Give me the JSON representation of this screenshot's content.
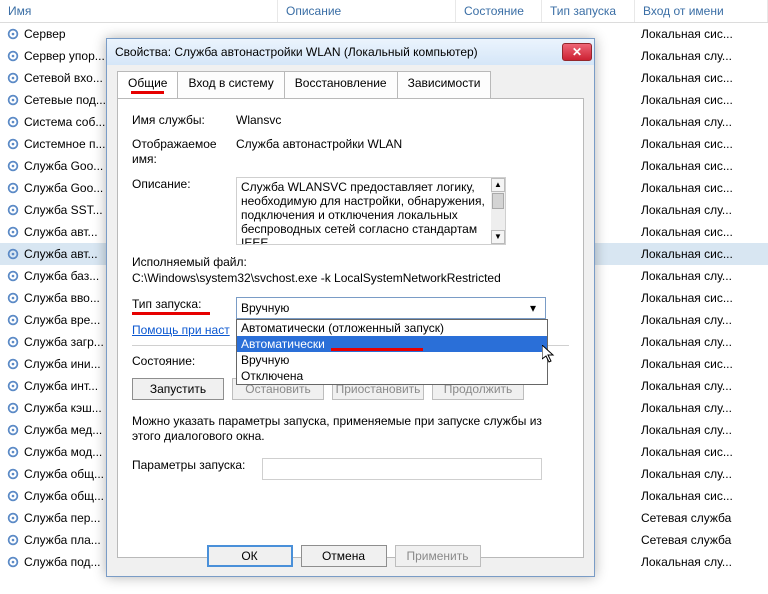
{
  "columns": {
    "name": "Имя",
    "desc": "Описание",
    "state": "Состояние",
    "start": "Тип запуска",
    "logon": "Вход от имени"
  },
  "rows": [
    {
      "name": "Сервер",
      "logon": "Локальная сис..."
    },
    {
      "name": "Сервер упор...",
      "logon": "Локальная слу..."
    },
    {
      "name": "Сетевой вхо...",
      "logon": "Локальная сис..."
    },
    {
      "name": "Сетевые под...",
      "logon": "Локальная сис..."
    },
    {
      "name": "Система соб...",
      "logon": "Локальная слу..."
    },
    {
      "name": "Системное п...",
      "logon": "Локальная сис..."
    },
    {
      "name": "Служба Goo...",
      "logon": "Локальная сис..."
    },
    {
      "name": "Служба Goo...",
      "logon": "Локальная сис..."
    },
    {
      "name": "Служба SST...",
      "logon": "Локальная слу..."
    },
    {
      "name": "Служба авт...",
      "logon": "Локальная сис..."
    },
    {
      "name": "Служба авт...",
      "sel": true,
      "logon": "Локальная сис..."
    },
    {
      "name": "Служба баз...",
      "logon": "Локальная слу..."
    },
    {
      "name": "Служба вво...",
      "logon": "Локальная сис..."
    },
    {
      "name": "Служба вре...",
      "logon": "Локальная слу..."
    },
    {
      "name": "Служба загр...",
      "logon": "Локальная слу..."
    },
    {
      "name": "Служба ини...",
      "logon": "Локальная сис..."
    },
    {
      "name": "Служба инт...",
      "logon": "Локальная слу..."
    },
    {
      "name": "Служба кэш...",
      "logon": "Локальная слу..."
    },
    {
      "name": "Служба мед...",
      "logon": "Локальная слу..."
    },
    {
      "name": "Служба мод...",
      "logon": "Локальная сис..."
    },
    {
      "name": "Служба общ...",
      "logon": "Локальная слу..."
    },
    {
      "name": "Служба общ...",
      "logon": "Локальная сис..."
    },
    {
      "name": "Служба пер...",
      "logon": "Сетевая служба"
    },
    {
      "name": "Служба пла...",
      "logon": "Сетевая служба"
    },
    {
      "name": "Служба под...",
      "logon": "Локальная слу..."
    }
  ],
  "dialog": {
    "title": "Свойства: Служба автонастройки WLAN (Локальный компьютер)",
    "tabs": [
      "Общие",
      "Вход в систему",
      "Восстановление",
      "Зависимости"
    ],
    "fields": {
      "svc_name_lbl": "Имя службы:",
      "svc_name": "Wlansvc",
      "disp_lbl": "Отображаемое имя:",
      "disp": "Служба автонастройки WLAN",
      "desc_lbl": "Описание:",
      "desc": "Служба WLANSVC предоставляет логику, необходимую для настройки, обнаружения, подключения и отключения локальных беспроводных сетей согласно стандартам IEEE",
      "exe_lbl": "Исполняемый файл:",
      "exe": "C:\\Windows\\system32\\svchost.exe -k LocalSystemNetworkRestricted",
      "startup_lbl": "Тип запуска:",
      "startup_val": "Вручную",
      "help": "Помощь при наст",
      "state_lbl": "Состояние:",
      "note": "Можно указать параметры запуска, применяемые при запуске службы из этого диалогового окна.",
      "params_lbl": "Параметры запуска:"
    },
    "options": [
      "Автоматически (отложенный запуск)",
      "Автоматически",
      "Вручную",
      "Отключена"
    ],
    "buttons": {
      "start": "Запустить",
      "stop": "Остановить",
      "pause": "Приостановить",
      "resume": "Продолжить",
      "ok": "ОК",
      "cancel": "Отмена",
      "apply": "Применить"
    }
  }
}
